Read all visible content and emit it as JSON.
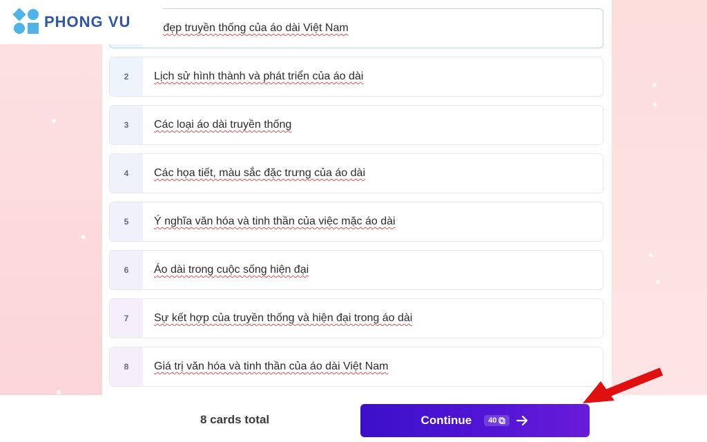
{
  "logo": {
    "text": "PHONG VU",
    "brand_color": "#2e56a6",
    "accent_color": "#4fb3e8"
  },
  "cards": [
    {
      "num": "",
      "title": "ẻ đẹp truyền thống của áo dài Việt Nam",
      "active": true
    },
    {
      "num": "2",
      "title": "Lịch sử hình thành và phát triển của áo dài"
    },
    {
      "num": "3",
      "title": "Các loại áo dài truyền thống"
    },
    {
      "num": "4",
      "title": "Các họa tiết, màu sắc đặc trưng của áo dài"
    },
    {
      "num": "5",
      "title": "Ý nghĩa văn hóa và tinh thần của việc mặc áo dài"
    },
    {
      "num": "6",
      "title": "Áo dài trong cuộc sống hiện đại"
    },
    {
      "num": "7",
      "title": "Sự kết hợp của truyền thống và hiện đại trong áo dài"
    },
    {
      "num": "8",
      "title": "Giá trị văn hóa và tinh thần của áo dài Việt Nam"
    }
  ],
  "footer": {
    "total_label": "8 cards total",
    "continue_label": "Continue",
    "credits": "40",
    "button_color": "#4a12d0"
  },
  "annotation": {
    "arrow_color": "#e01010"
  }
}
